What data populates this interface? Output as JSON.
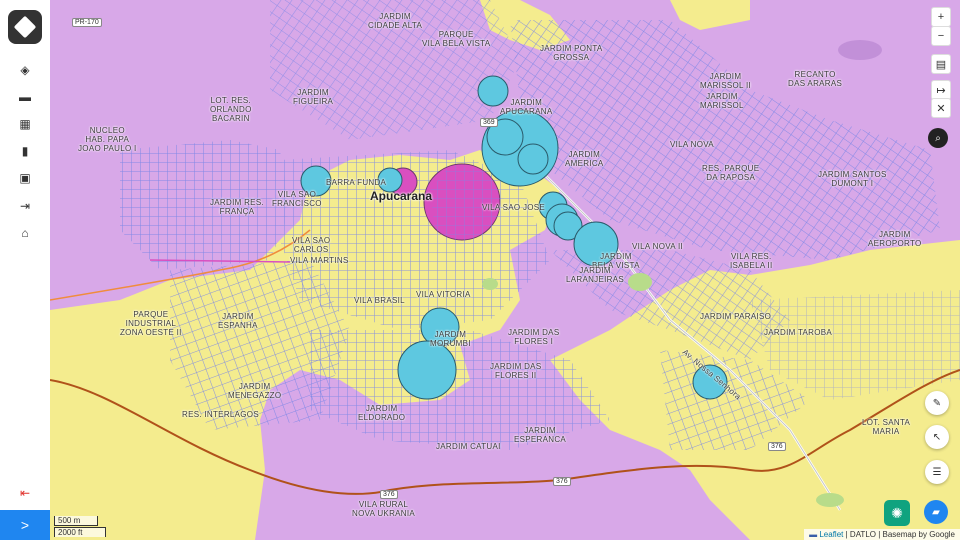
{
  "sidebar": {
    "items": [
      {
        "name": "layers-icon",
        "glyph": "◈"
      },
      {
        "name": "folder-icon",
        "glyph": "▬"
      },
      {
        "name": "map-icon",
        "glyph": "▦"
      },
      {
        "name": "chart-icon",
        "glyph": "▮"
      },
      {
        "name": "grid-icon",
        "glyph": "▣"
      },
      {
        "name": "export-icon",
        "glyph": "⇥"
      },
      {
        "name": "home-icon",
        "glyph": "⌂"
      }
    ],
    "logout_glyph": "⇤",
    "expand_glyph": ">"
  },
  "map": {
    "city_label": "Apucarana",
    "labels": [
      {
        "t": "JARDIM\nCIDADE ALTA"
      },
      {
        "t": "PARQUE\nVILA BELA VISTA"
      },
      {
        "t": "JARDIM PONTA\nGROSSA"
      },
      {
        "t": "RECANTO\nDAS ARARAS"
      },
      {
        "t": "JARDIM\nMARISSOL II"
      },
      {
        "t": "JARDIM\nMARISSOL"
      },
      {
        "t": "LOT. RES.\nORLANDO\nBACARIN"
      },
      {
        "t": "JARDIM\nFIGUEIRA"
      },
      {
        "t": "JARDIM\nAPUCARANA"
      },
      {
        "t": "NUCLEO\nHAB. PAPA\nJOAO PAULO I"
      },
      {
        "t": "VILA NOVA"
      },
      {
        "t": "JARDIM\nAMERICA"
      },
      {
        "t": "RES. PARQUE\nDA RAPOSA"
      },
      {
        "t": "JARDIM SANTOS\nDUMONT I"
      },
      {
        "t": "BARRA FUNDA"
      },
      {
        "t": "VILA SAO\nFRANCISCO"
      },
      {
        "t": "JARDIM RES.\nFRANÇA"
      },
      {
        "t": "VILA SAO JOSE"
      },
      {
        "t": "VILA SAO\nCARLOS"
      },
      {
        "t": "VILA MARTINS"
      },
      {
        "t": "VILA NOVA II"
      },
      {
        "t": "JARDIM\nAEROPORTO"
      },
      {
        "t": "JARDIM\nBELA VISTA"
      },
      {
        "t": "VILA RES.\nISABELA II"
      },
      {
        "t": "JARDIM\nLARANJEIRAS"
      },
      {
        "t": "VILA BRASIL"
      },
      {
        "t": "VILA VITORIA"
      },
      {
        "t": "PARQUE\nINDUSTRIAL\nZONA OESTE II"
      },
      {
        "t": "JARDIM\nESPANHA"
      },
      {
        "t": "JARDIM\nMORUMBI"
      },
      {
        "t": "JARDIM DAS\nFLORES I"
      },
      {
        "t": "JARDIM PARAISO"
      },
      {
        "t": "JARDIM TAROBA"
      },
      {
        "t": "JARDIM DAS\nFLORES II"
      },
      {
        "t": "JARDIM\nMENEGAZZO"
      },
      {
        "t": "RES. INTERLAGOS"
      },
      {
        "t": "JARDIM\nELDORADO"
      },
      {
        "t": "JARDIM\nESPERANCA"
      },
      {
        "t": "JARDIM CATUAI"
      },
      {
        "t": "LOT. SANTA\nMARIA"
      },
      {
        "t": "VILA RURAL\nNOVA UKRANIA"
      }
    ],
    "road_labels": [
      "PR-170",
      "369",
      "376",
      "376",
      "376"
    ],
    "avenue_label": "Av. Nossa Senhora"
  },
  "controls": {
    "zoom_in": "+",
    "zoom_out": "−",
    "basemap_glyph": "▤",
    "measure_glyph": "↦",
    "clear_glyph": "✕",
    "search_glyph": "⌕",
    "draw_glyph": "✎",
    "select_glyph": "↖",
    "list_glyph": "☰",
    "chatgpt_glyph": "✺",
    "chat_glyph": "▰"
  },
  "scale": {
    "metric": "500 m",
    "imperial": "2000 ft"
  },
  "attribution": {
    "leaflet": "Leaflet",
    "rest": "| DATLO | Basemap by Google",
    "flag": "▬"
  },
  "colors": {
    "purple_zone": "#d8a8e8",
    "yellow_zone": "#f4ec8e",
    "magenta_zone": "#d94fc0",
    "bubble": "#5ec8e0",
    "street": "#7a86e6",
    "accent": "#1f86f0"
  }
}
